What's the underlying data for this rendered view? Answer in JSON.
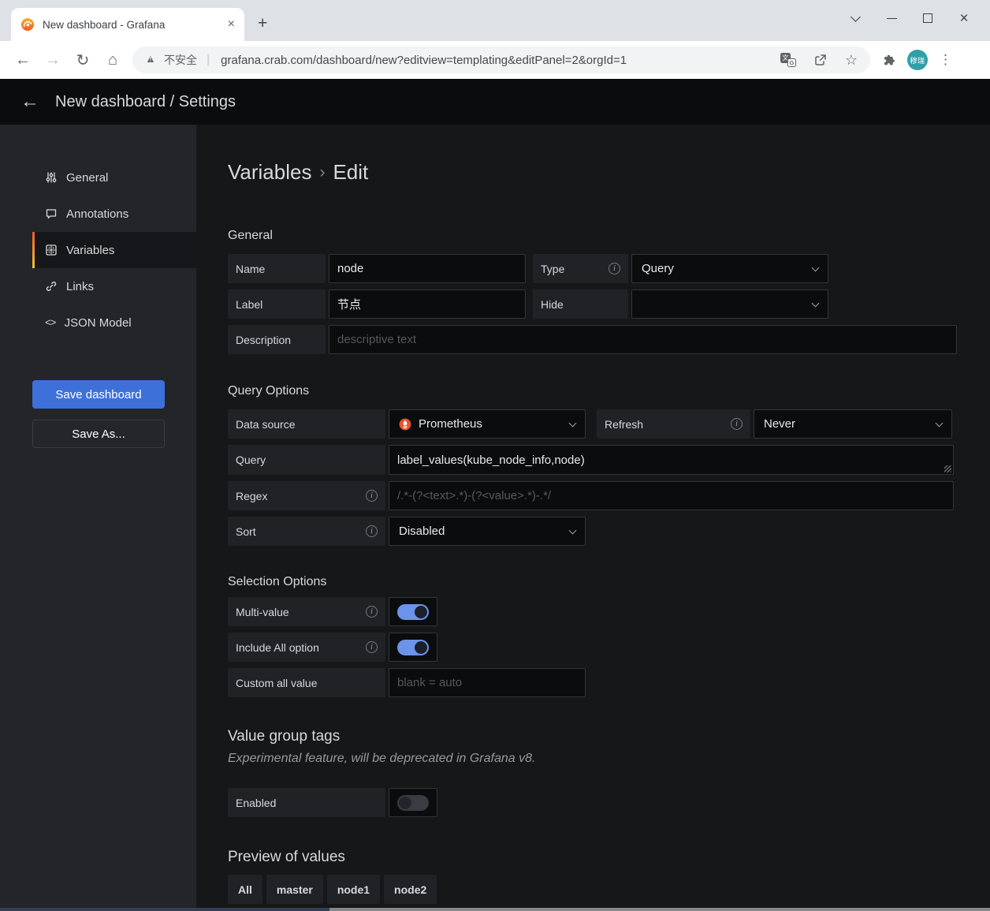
{
  "icons": {
    "back": "←",
    "forward": "→",
    "reload": "↻",
    "home": "⌂",
    "warning": "▲",
    "warning_mark": "!",
    "separator": "|",
    "star": "☆",
    "menu": "⋮",
    "close": "×",
    "new_tab": "+",
    "tab_close": "×",
    "info": "i",
    "json_model": "<>",
    "crumb_sep": "›",
    "translate_main": "文",
    "translate_sub": "G",
    "back_arrow": "←"
  },
  "browser": {
    "tab_title": "New dashboard - Grafana",
    "url_warning": "不安全",
    "url": "grafana.crab.com/dashboard/new?editview=templating&editPanel=2&orgId=1",
    "profile_initials": "穆瑞"
  },
  "app_header": {
    "title": "New dashboard / Settings"
  },
  "sidebar": {
    "items": [
      {
        "label": "General"
      },
      {
        "label": "Annotations"
      },
      {
        "label": "Variables",
        "active": true
      },
      {
        "label": "Links"
      },
      {
        "label": "JSON Model"
      }
    ],
    "save_button": "Save dashboard",
    "save_as_button": "Save As..."
  },
  "main": {
    "breadcrumb": {
      "section": "Variables",
      "page": "Edit"
    },
    "general": {
      "heading": "General",
      "name_label": "Name",
      "name_value": "node",
      "type_label": "Type",
      "type_value": "Query",
      "label_label": "Label",
      "label_value": "节点",
      "hide_label": "Hide",
      "hide_value": "",
      "description_label": "Description",
      "description_placeholder": "descriptive text"
    },
    "query_options": {
      "heading": "Query Options",
      "data_source_label": "Data source",
      "data_source_value": "Prometheus",
      "refresh_label": "Refresh",
      "refresh_value": "Never",
      "query_label": "Query",
      "query_value": "label_values(kube_node_info,node)",
      "regex_label": "Regex",
      "regex_placeholder": "/.*-(?<text>.*)-(?<value>.*)-.*/",
      "sort_label": "Sort",
      "sort_value": "Disabled"
    },
    "selection_options": {
      "heading": "Selection Options",
      "multi_value_label": "Multi-value",
      "multi_value_on": true,
      "include_all_label": "Include All option",
      "include_all_on": true,
      "custom_all_label": "Custom all value",
      "custom_all_placeholder": "blank = auto"
    },
    "value_group_tags": {
      "heading": "Value group tags",
      "note": "Experimental feature, will be deprecated in Grafana v8.",
      "enabled_label": "Enabled",
      "enabled_on": false
    },
    "preview": {
      "heading": "Preview of values",
      "chips": [
        "All",
        "master",
        "node1",
        "node2"
      ]
    }
  },
  "colors": {
    "accent_blue": "#3d71d9",
    "toggle_on": "#6c93ea",
    "prometheus_orange": "#e6522c",
    "active_border_top": "#f05a28",
    "active_border_bottom": "#f5c233",
    "avatar_teal": "#2f9faa"
  }
}
